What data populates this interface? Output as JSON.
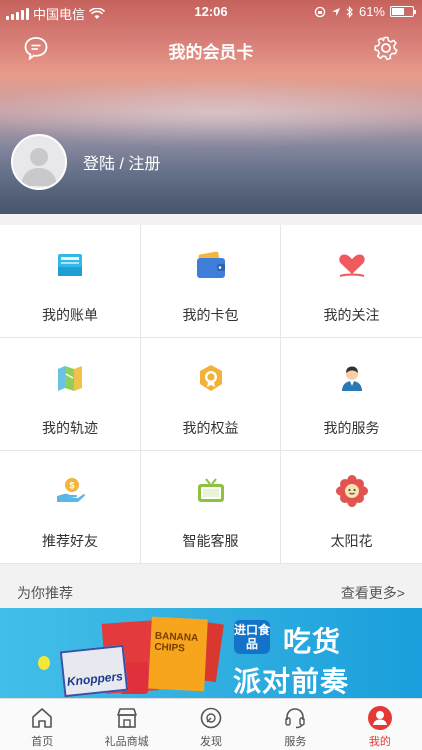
{
  "status_bar": {
    "carrier": "中国电信",
    "time": "12:06",
    "battery": "61%",
    "battery_level": 0.61
  },
  "header": {
    "title": "我的会员卡",
    "login_label": "登陆 / 注册"
  },
  "menu": [
    {
      "label": "我的账单",
      "icon": "bill-icon"
    },
    {
      "label": "我的卡包",
      "icon": "wallet-icon"
    },
    {
      "label": "我的关注",
      "icon": "heart-icon"
    },
    {
      "label": "我的轨迹",
      "icon": "map-icon"
    },
    {
      "label": "我的权益",
      "icon": "badge-icon"
    },
    {
      "label": "我的服务",
      "icon": "service-person-icon"
    },
    {
      "label": "推荐好友",
      "icon": "coin-hand-icon"
    },
    {
      "label": "智能客服",
      "icon": "tv-icon"
    },
    {
      "label": "太阳花",
      "icon": "flower-icon"
    }
  ],
  "recommend": {
    "title": "为你推荐",
    "more": "查看更多>"
  },
  "banner": {
    "tag": "进口食品",
    "headline_1": "吃货",
    "headline_2": "派对前奏",
    "pack_label": "Knoppers",
    "chips_label": "BANANA CHIPS"
  },
  "tabs": [
    {
      "label": "首页",
      "icon": "home-icon"
    },
    {
      "label": "礼品商城",
      "icon": "shop-icon"
    },
    {
      "label": "发现",
      "icon": "discover-icon"
    },
    {
      "label": "服务",
      "icon": "headset-icon"
    },
    {
      "label": "我的",
      "icon": "profile-icon",
      "active": true
    }
  ],
  "colors": {
    "accent": "#e53935",
    "banner": "#33b0e0"
  }
}
